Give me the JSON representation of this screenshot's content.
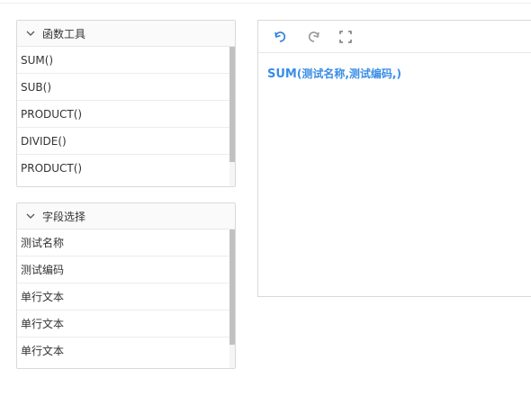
{
  "function_panel": {
    "title": "函数工具",
    "items": [
      "SUM()",
      "SUB()",
      "PRODUCT()",
      "DIVIDE()",
      "PRODUCT()"
    ]
  },
  "field_panel": {
    "title": "字段选择",
    "items": [
      "测试名称",
      "测试编码",
      "单行文本",
      "单行文本",
      "单行文本"
    ]
  },
  "editor": {
    "toolbar": {
      "undo_icon": "undo-icon",
      "redo_icon": "redo-icon",
      "fullscreen_icon": "fullscreen-icon"
    },
    "formula_func": "SUM",
    "formula_args": "(测试名称,测试编码,)"
  },
  "colors": {
    "accent": "#3a8ee6",
    "icon_active": "#2d7fd8",
    "icon_inactive": "#999999"
  }
}
